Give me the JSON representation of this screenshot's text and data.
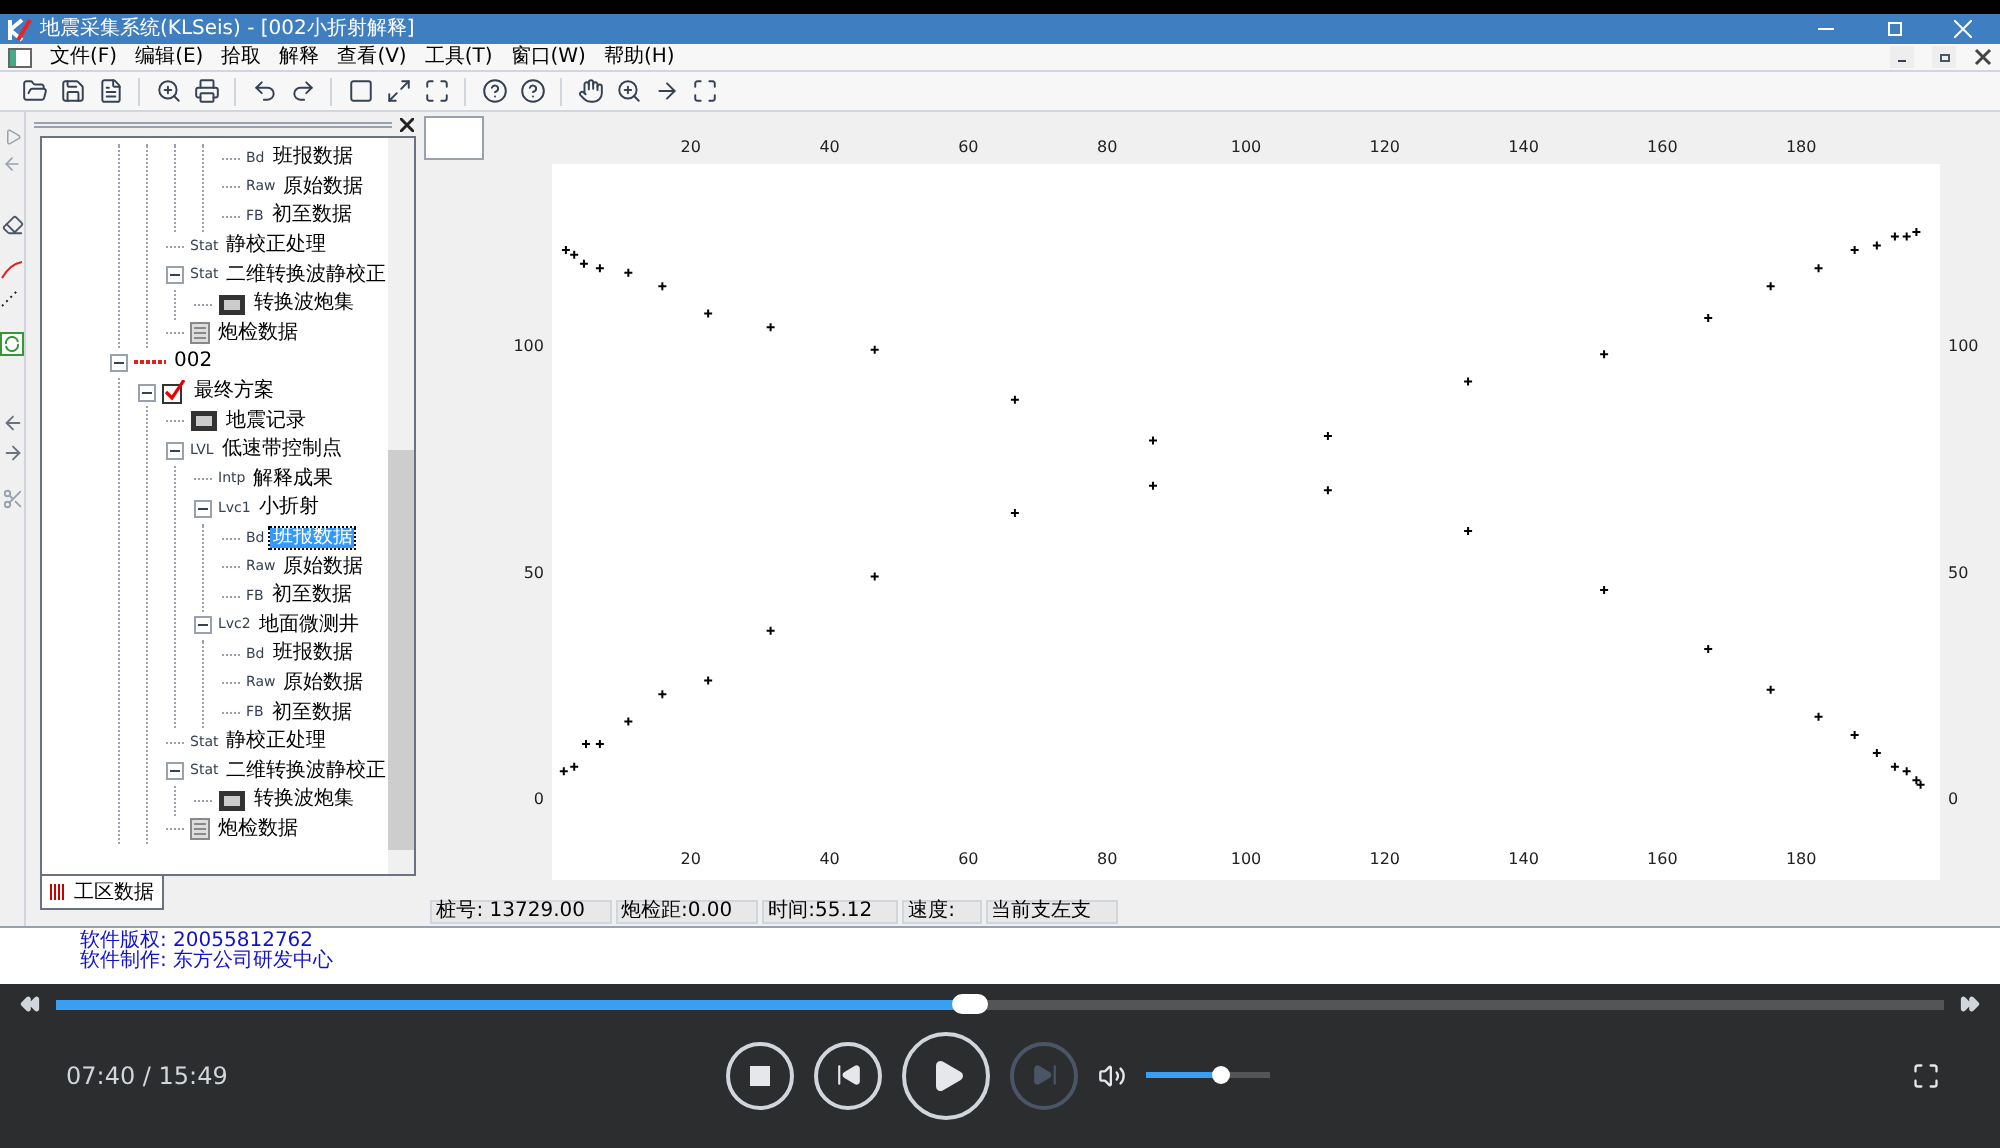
{
  "window": {
    "title": "地震采集系统(KLSeis) - [002小折射解释]"
  },
  "menu": [
    {
      "label": "文件(F)"
    },
    {
      "label": "编辑(E)"
    },
    {
      "label": "拾取"
    },
    {
      "label": "解释"
    },
    {
      "label": "查看(V)"
    },
    {
      "label": "工具(T)"
    },
    {
      "label": "窗口(W)"
    },
    {
      "label": "帮助(H)"
    }
  ],
  "tree": {
    "items": [
      {
        "children": [
          {
            "children": [
              {
                "children": [
                  {
                    "children": [
                      {
                        "tag": "Bd",
                        "label": "班报数据",
                        "selected": false
                      },
                      {
                        "tag": "Raw",
                        "label": "原始数据",
                        "selected": false
                      },
                      {
                        "tag": "FB",
                        "label": "初至数据",
                        "selected": false
                      }
                    ]
                  }
                ]
              },
              {
                "tag": "Stat",
                "label": "静校正处理",
                "selected": false
              },
              {
                "tag": "Stat",
                "label": "二维转换波静校正",
                "selected": false,
                "expanded": true,
                "children": [
                  {
                    "kind": "record",
                    "label": "转换波炮集",
                    "selected": false
                  }
                ]
              },
              {
                "kind": "list",
                "label": "炮检数据",
                "selected": false
              }
            ]
          }
        ]
      },
      {
        "kind": "line",
        "label": "002",
        "selected": false,
        "expanded": true,
        "children": [
          {
            "kind": "check",
            "label": "最终方案",
            "selected": false,
            "expanded": true,
            "children": [
              {
                "kind": "record",
                "label": "地震记录",
                "selected": false
              },
              {
                "tag": "LVL",
                "label": "低速带控制点",
                "selected": false,
                "expanded": true,
                "children": [
                  {
                    "tag": "Intp",
                    "label": "解释成果",
                    "selected": false
                  },
                  {
                    "tag": "Lvc1",
                    "label": "小折射",
                    "selected": false,
                    "expanded": true,
                    "children": [
                      {
                        "tag": "Bd",
                        "label": "班报数据",
                        "selected": true
                      },
                      {
                        "tag": "Raw",
                        "label": "原始数据",
                        "selected": false
                      },
                      {
                        "tag": "FB",
                        "label": "初至数据",
                        "selected": false
                      }
                    ]
                  },
                  {
                    "tag": "Lvc2",
                    "label": "地面微测井",
                    "selected": false,
                    "expanded": true,
                    "children": [
                      {
                        "tag": "Bd",
                        "label": "班报数据",
                        "selected": false
                      },
                      {
                        "tag": "Raw",
                        "label": "原始数据",
                        "selected": false
                      },
                      {
                        "tag": "FB",
                        "label": "初至数据",
                        "selected": false
                      }
                    ]
                  }
                ]
              },
              {
                "tag": "Stat",
                "label": "静校正处理",
                "selected": false
              },
              {
                "tag": "Stat",
                "label": "二维转换波静校正",
                "selected": false,
                "expanded": true,
                "children": [
                  {
                    "kind": "record",
                    "label": "转换波炮集",
                    "selected": false
                  }
                ]
              },
              {
                "kind": "list",
                "label": "炮检数据",
                "selected": false
              }
            ]
          }
        ]
      }
    ],
    "tab": "工区数据"
  },
  "plot": {
    "top_axis_labels": [
      "20",
      "40",
      "60",
      "80",
      "100",
      "120",
      "140",
      "160",
      "180"
    ],
    "right_axis_labels": [
      "100",
      "50",
      "0"
    ]
  },
  "chart_data": {
    "type": "scatter",
    "xlim": [
      0,
      200
    ],
    "ylim": [
      -18,
      140
    ],
    "xticks": [
      20,
      40,
      60,
      80,
      100,
      120,
      140,
      160,
      180
    ],
    "yticks": [
      0,
      50,
      100
    ],
    "series": [
      {
        "color": "#000000",
        "x": [
          2,
          3.2,
          4.6,
          6.9,
          11,
          15.9,
          22.5,
          31.5,
          46.5,
          66.7,
          86.6,
          111.8,
          132,
          151.6,
          166.6,
          175.6,
          182.5,
          187.7,
          190.9,
          193.5,
          195.2,
          196.6,
          197.2
        ],
        "values": [
          121,
          120,
          118,
          117,
          116,
          113,
          107,
          104,
          99,
          88,
          79,
          68,
          59,
          46,
          33,
          24,
          18,
          14,
          10,
          7,
          6,
          4,
          3
        ]
      },
      {
        "color": "#000000",
        "x": [
          1.7,
          3.2,
          4.9,
          6.9,
          11,
          15.9,
          22.5,
          31.5,
          46.5,
          66.7,
          86.6,
          111.8,
          132,
          151.6,
          166.6,
          175.6,
          182.5,
          187.7,
          190.9,
          193.5,
          195.2,
          196.6
        ],
        "values": [
          6,
          7,
          12,
          12,
          17,
          23,
          26,
          37,
          49,
          63,
          69,
          80,
          92,
          98,
          106,
          113,
          117,
          121,
          122,
          124,
          124,
          125
        ]
      }
    ]
  },
  "status_bar": [
    "桩号: 13729.00",
    "炮检距:0.00",
    "时间:55.12",
    "速度:",
    "当前支左支"
  ],
  "log": [
    "软件版权: 20055812762",
    "软件制作: 东方公司研发中心"
  ],
  "player": {
    "progress": {
      "level": 0.484
    },
    "time": "07:40 / 15:49",
    "volume": {
      "level": 0.6
    },
    "next_disabled": true
  }
}
